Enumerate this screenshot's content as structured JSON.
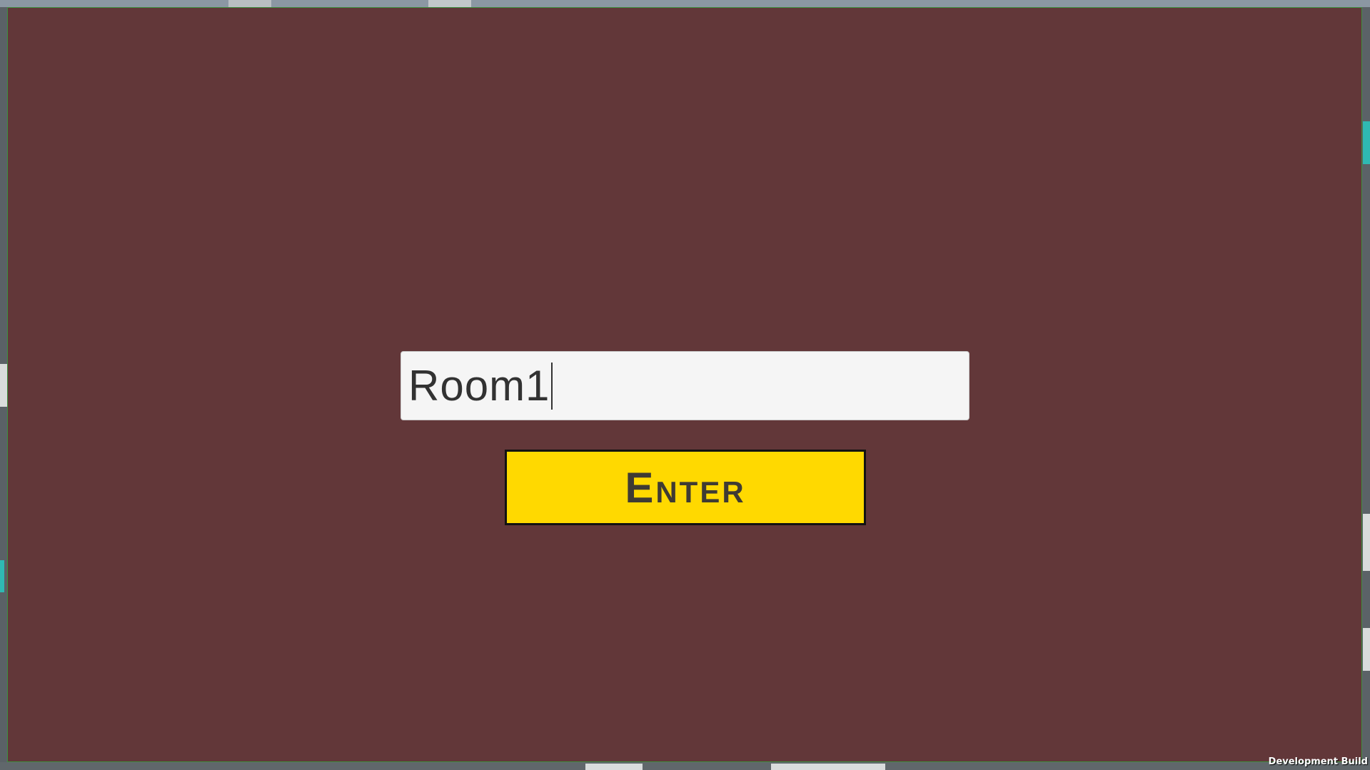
{
  "room_input": {
    "value": "Room1"
  },
  "enter_button": {
    "label": "Enter"
  },
  "watermark": {
    "text": "Development Build"
  },
  "colors": {
    "panel": "#623739",
    "input_bg": "#f5f5f5",
    "button_bg": "#ffd900",
    "button_text": "#3f3b33",
    "input_text": "#323232"
  }
}
